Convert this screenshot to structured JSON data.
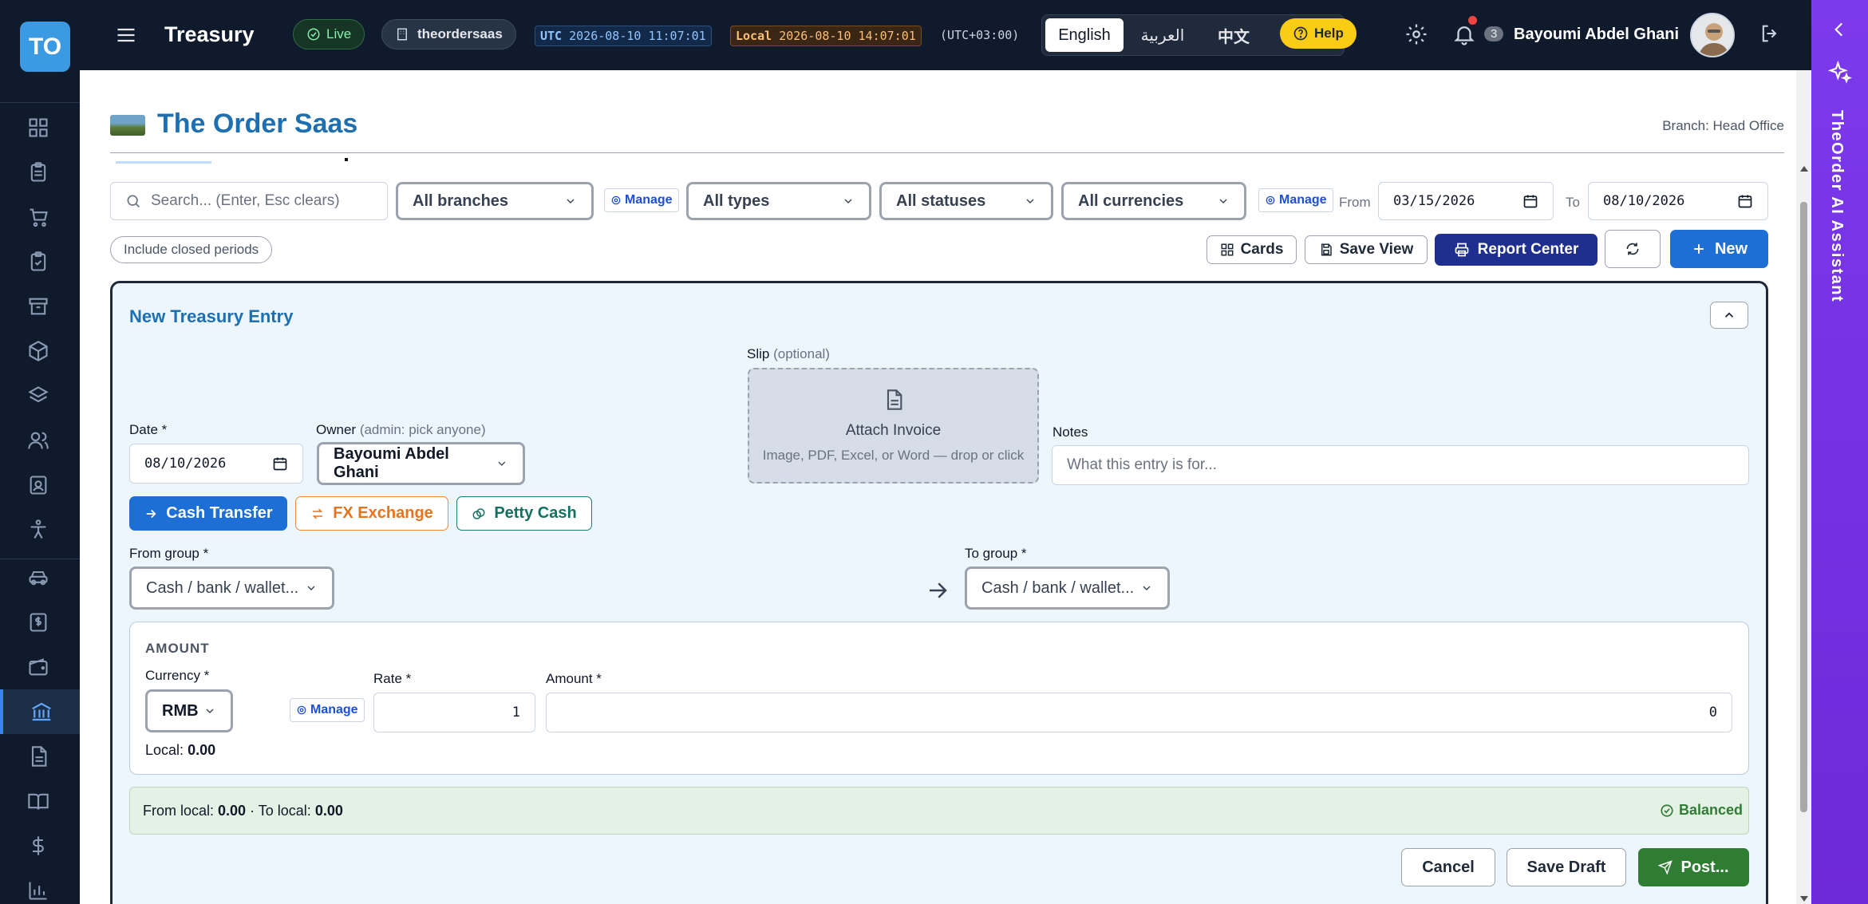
{
  "app": {
    "logo_text": "TO",
    "title": "Treasury",
    "live_label": "Live",
    "tenant": "theordersaas",
    "utc_label": "UTC",
    "utc_time": "2026-08-10 11:07:01",
    "local_label": "Local",
    "local_time": "2026-08-10 14:07:01",
    "tz_offset": "(UTC+03:00)",
    "languages": [
      "English",
      "العربية",
      "中文"
    ],
    "help_label": "Help",
    "notification_count": "3",
    "user_name": "Bayoumi Abdel Ghani"
  },
  "ai_panel": {
    "title": "TheOrder AI Assistant"
  },
  "page": {
    "company": "The Order Saas",
    "branch": "Branch: Head Office"
  },
  "filters": {
    "search_placeholder": "Search... (Enter, Esc clears)",
    "branches": "All branches",
    "manage": "Manage",
    "types": "All types",
    "statuses": "All statuses",
    "currencies": "All currencies",
    "from_label": "From",
    "from_date": "03/15/2026",
    "to_label": "To",
    "to_date": "08/10/2026",
    "include_closed": "Include closed periods"
  },
  "toolbar": {
    "cards": "Cards",
    "save_view": "Save View",
    "report_center": "Report Center",
    "new": "New"
  },
  "form": {
    "title": "New Treasury Entry",
    "slip_label": "Slip",
    "slip_optional": "(optional)",
    "attach_title": "Attach Invoice",
    "attach_hint": "Image, PDF, Excel, or Word — drop or click",
    "date_label": "Date *",
    "date_value": "08/10/2026",
    "owner_label": "Owner",
    "owner_hint": "(admin: pick anyone)",
    "owner_value": "Bayoumi Abdel Ghani",
    "notes_label": "Notes",
    "notes_placeholder": "What this entry is for...",
    "types": {
      "cash_transfer": "Cash Transfer",
      "fx_exchange": "FX Exchange",
      "petty_cash": "Petty Cash"
    },
    "from_group_label": "From group *",
    "from_group_value": "Cash / bank / wallet...",
    "to_group_label": "To group *",
    "to_group_value": "Cash / bank / wallet...",
    "amount_section": "AMOUNT",
    "currency_label": "Currency *",
    "currency_value": "RMB",
    "manage": "Manage",
    "rate_label": "Rate *",
    "rate_value": "1",
    "amount_label": "Amount *",
    "amount_value": "0",
    "local_label": "Local:",
    "local_value": "0.00",
    "from_local_label": "From local:",
    "from_local_value": "0.00",
    "to_local_label": "· To local:",
    "to_local_value": "0.00",
    "balanced": "Balanced",
    "cancel": "Cancel",
    "save_draft": "Save Draft",
    "post": "Post..."
  },
  "colors": {
    "topbar": "#0f1b2d",
    "primary": "#1d6fd6",
    "navy": "#1e2f8f",
    "green": "#2e7d32",
    "ai_panel": "#7c3aed",
    "help": "#facc15",
    "form_bg": "#eef6fd",
    "balanced_bg": "#e3f2e5"
  }
}
